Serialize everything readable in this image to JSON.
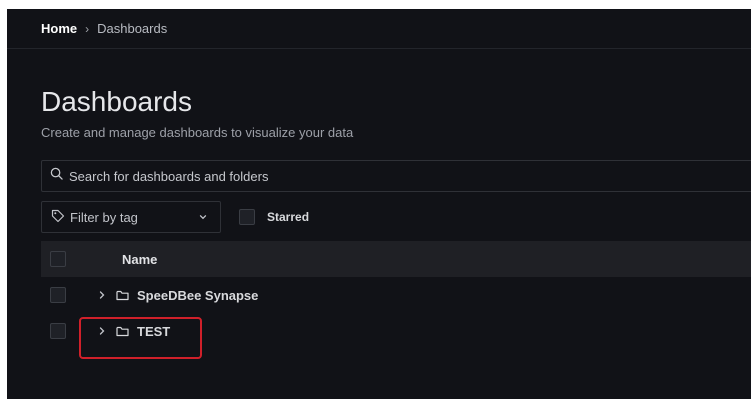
{
  "breadcrumb": {
    "home": "Home",
    "separator": "›",
    "current": "Dashboards"
  },
  "page": {
    "title": "Dashboards",
    "subtitle": "Create and manage dashboards to visualize your data"
  },
  "search": {
    "placeholder": "Search for dashboards and folders",
    "icon": "search-icon"
  },
  "filters": {
    "tag_label": "Filter by tag",
    "starred_label": "Starred"
  },
  "table": {
    "column_name": "Name",
    "rows": [
      {
        "label": "SpeeDBee Synapse",
        "icon": "folder-icon"
      },
      {
        "label": "TEST",
        "icon": "folder-icon"
      }
    ]
  },
  "colors": {
    "background": "#111217",
    "highlight": "#d0202a"
  }
}
